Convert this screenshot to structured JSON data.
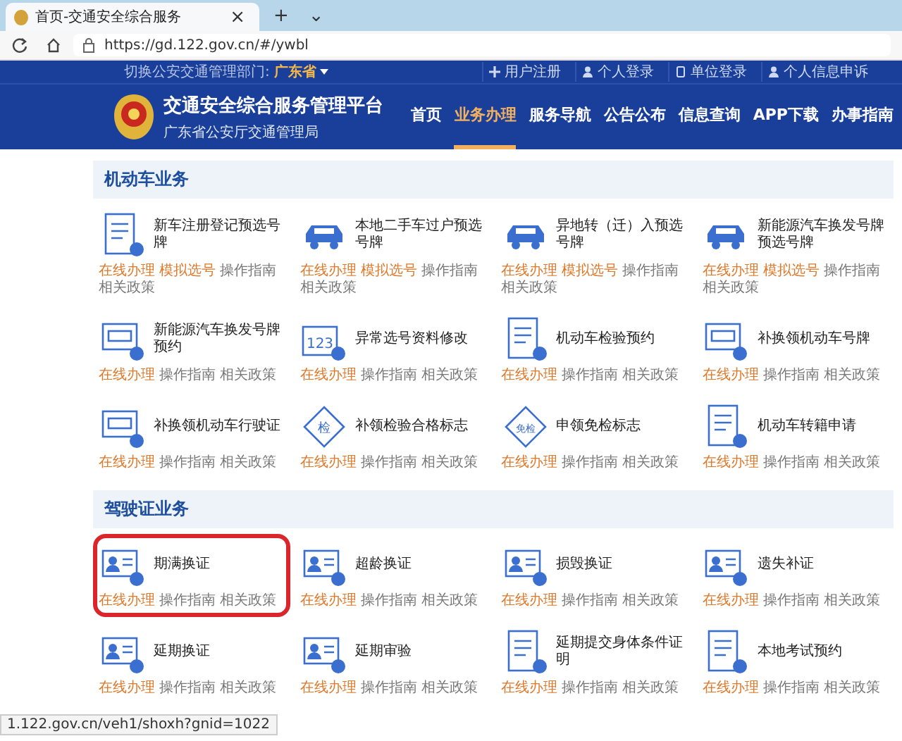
{
  "browser": {
    "tab": {
      "title": "首页-交通安全综合服务",
      "close": "×"
    },
    "new_tab": "+",
    "tab_menu": "⌄",
    "url": "https://gd.122.gov.cn/#/ywbl"
  },
  "topbar": {
    "switch_label": "切换公安交通管理部门:",
    "region": "广东省",
    "links": [
      {
        "label": "用户注册",
        "kind": "plus"
      },
      {
        "label": "个人登录",
        "kind": "person"
      },
      {
        "label": "单位登录",
        "kind": "phone"
      },
      {
        "label": "个人信息申诉",
        "kind": "person"
      }
    ]
  },
  "header": {
    "title": "交通安全综合服务管理平台",
    "subtitle": "广东省公安厅交通管理局",
    "nav": [
      {
        "label": "首页",
        "selected": false
      },
      {
        "label": "业务办理",
        "selected": true
      },
      {
        "label": "服务导航",
        "selected": false
      },
      {
        "label": "公告公布",
        "selected": false
      },
      {
        "label": "信息查询",
        "selected": false
      },
      {
        "label": "APP下载",
        "selected": false
      },
      {
        "label": "办事指南",
        "selected": false
      }
    ]
  },
  "sections": [
    {
      "title": "机动车业务",
      "items": [
        {
          "title": "新车注册登记预选号牌",
          "kind": "document",
          "highlighted": false,
          "links": [
            {
              "label": "在线办理",
              "kind": "primary"
            },
            {
              "label": "模拟选号",
              "kind": "primary"
            },
            {
              "label": "操作指南",
              "kind": "secondary"
            },
            {
              "label": "相关政策",
              "kind": "secondary"
            }
          ]
        },
        {
          "title": "本地二手车过户预选号牌",
          "kind": "car",
          "highlighted": false,
          "links": [
            {
              "label": "在线办理",
              "kind": "primary"
            },
            {
              "label": "模拟选号",
              "kind": "primary"
            },
            {
              "label": "操作指南",
              "kind": "secondary"
            },
            {
              "label": "相关政策",
              "kind": "secondary"
            }
          ]
        },
        {
          "title": "异地转（迁）入预选号牌",
          "kind": "car",
          "highlighted": false,
          "links": [
            {
              "label": "在线办理",
              "kind": "primary"
            },
            {
              "label": "模拟选号",
              "kind": "primary"
            },
            {
              "label": "操作指南",
              "kind": "secondary"
            },
            {
              "label": "相关政策",
              "kind": "secondary"
            }
          ]
        },
        {
          "title": "新能源汽车换发号牌预选号牌",
          "kind": "car",
          "highlighted": false,
          "links": [
            {
              "label": "在线办理",
              "kind": "primary"
            },
            {
              "label": "模拟选号",
              "kind": "primary"
            },
            {
              "label": "操作指南",
              "kind": "secondary"
            },
            {
              "label": "相关政策",
              "kind": "secondary"
            }
          ]
        },
        {
          "title": "新能源汽车换发号牌预约",
          "kind": "plate",
          "highlighted": false,
          "links": [
            {
              "label": "在线办理",
              "kind": "primary"
            },
            {
              "label": "操作指南",
              "kind": "secondary"
            },
            {
              "label": "相关政策",
              "kind": "secondary"
            }
          ]
        },
        {
          "title": "异常选号资料修改",
          "kind": "number",
          "icon_text": "123",
          "highlighted": false,
          "links": [
            {
              "label": "在线办理",
              "kind": "primary"
            },
            {
              "label": "操作指南",
              "kind": "secondary"
            },
            {
              "label": "相关政策",
              "kind": "secondary"
            }
          ]
        },
        {
          "title": "机动车检验预约",
          "kind": "document",
          "highlighted": false,
          "links": [
            {
              "label": "在线办理",
              "kind": "primary"
            },
            {
              "label": "操作指南",
              "kind": "secondary"
            },
            {
              "label": "相关政策",
              "kind": "secondary"
            }
          ]
        },
        {
          "title": "补换领机动车号牌",
          "kind": "plate",
          "highlighted": false,
          "links": [
            {
              "label": "在线办理",
              "kind": "primary"
            },
            {
              "label": "操作指南",
              "kind": "secondary"
            },
            {
              "label": "相关政策",
              "kind": "secondary"
            }
          ]
        },
        {
          "title": "补换领机动车行驶证",
          "kind": "plate",
          "highlighted": false,
          "links": [
            {
              "label": "在线办理",
              "kind": "primary"
            },
            {
              "label": "操作指南",
              "kind": "secondary"
            },
            {
              "label": "相关政策",
              "kind": "secondary"
            }
          ]
        },
        {
          "title": "补领检验合格标志",
          "kind": "diamond",
          "icon_text": "检",
          "highlighted": false,
          "links": [
            {
              "label": "在线办理",
              "kind": "primary"
            },
            {
              "label": "操作指南",
              "kind": "secondary"
            },
            {
              "label": "相关政策",
              "kind": "secondary"
            }
          ]
        },
        {
          "title": "申领免检标志",
          "kind": "diamond",
          "icon_text": "免检",
          "highlighted": false,
          "links": [
            {
              "label": "在线办理",
              "kind": "primary"
            },
            {
              "label": "操作指南",
              "kind": "secondary"
            },
            {
              "label": "相关政策",
              "kind": "secondary"
            }
          ]
        },
        {
          "title": "机动车转籍申请",
          "kind": "document",
          "highlighted": false,
          "links": [
            {
              "label": "在线办理",
              "kind": "primary"
            },
            {
              "label": "操作指南",
              "kind": "secondary"
            },
            {
              "label": "相关政策",
              "kind": "secondary"
            }
          ]
        }
      ]
    },
    {
      "title": "驾驶证业务",
      "items": [
        {
          "title": "期满换证",
          "kind": "id-card",
          "highlighted": true,
          "links": [
            {
              "label": "在线办理",
              "kind": "primary"
            },
            {
              "label": "操作指南",
              "kind": "secondary"
            },
            {
              "label": "相关政策",
              "kind": "secondary"
            }
          ]
        },
        {
          "title": "超龄换证",
          "kind": "id-card",
          "highlighted": false,
          "links": [
            {
              "label": "在线办理",
              "kind": "primary"
            },
            {
              "label": "操作指南",
              "kind": "secondary"
            },
            {
              "label": "相关政策",
              "kind": "secondary"
            }
          ]
        },
        {
          "title": "损毁换证",
          "kind": "id-card",
          "highlighted": false,
          "links": [
            {
              "label": "在线办理",
              "kind": "primary"
            },
            {
              "label": "操作指南",
              "kind": "secondary"
            },
            {
              "label": "相关政策",
              "kind": "secondary"
            }
          ]
        },
        {
          "title": "遗失补证",
          "kind": "id-card",
          "highlighted": false,
          "links": [
            {
              "label": "在线办理",
              "kind": "primary"
            },
            {
              "label": "操作指南",
              "kind": "secondary"
            },
            {
              "label": "相关政策",
              "kind": "secondary"
            }
          ]
        },
        {
          "title": "延期换证",
          "kind": "id-card",
          "highlighted": false,
          "links": [
            {
              "label": "在线办理",
              "kind": "primary"
            },
            {
              "label": "操作指南",
              "kind": "secondary"
            },
            {
              "label": "相关政策",
              "kind": "secondary"
            }
          ]
        },
        {
          "title": "延期审验",
          "kind": "id-card",
          "highlighted": false,
          "links": [
            {
              "label": "在线办理",
              "kind": "primary"
            },
            {
              "label": "操作指南",
              "kind": "secondary"
            },
            {
              "label": "相关政策",
              "kind": "secondary"
            }
          ]
        },
        {
          "title": "延期提交身体条件证明",
          "kind": "document",
          "highlighted": false,
          "links": [
            {
              "label": "在线办理",
              "kind": "primary"
            },
            {
              "label": "操作指南",
              "kind": "secondary"
            },
            {
              "label": "相关政策",
              "kind": "secondary"
            }
          ]
        },
        {
          "title": "本地考试预约",
          "kind": "document",
          "highlighted": false,
          "links": [
            {
              "label": "在线办理",
              "kind": "primary"
            },
            {
              "label": "操作指南",
              "kind": "secondary"
            },
            {
              "label": "相关政策",
              "kind": "secondary"
            }
          ]
        }
      ]
    }
  ],
  "status_url": "1.122.gov.cn/veh1/shoxh?gnid=1022"
}
